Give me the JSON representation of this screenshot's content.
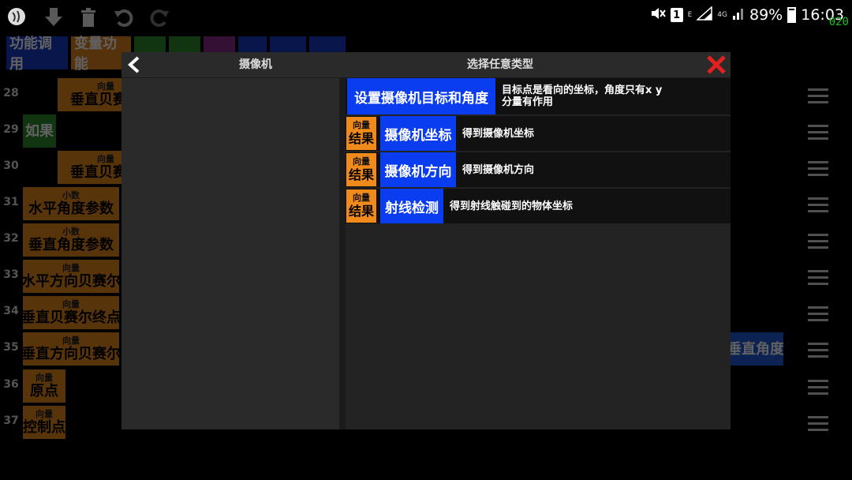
{
  "status_bar": {
    "mini_label_1": "E",
    "sim_badge": "1",
    "network": "4G",
    "battery_percent": "89%",
    "battery_level": 0.89,
    "time": "16:03",
    "fps": "020"
  },
  "background": {
    "tabs": [
      {
        "label": "功能调用",
        "color": "#1a3cc8"
      },
      {
        "label": "变量功能",
        "color": "#e08020"
      },
      {
        "label": "",
        "color": "#2f8a2f"
      },
      {
        "label": "",
        "color": "#2f8a2f"
      },
      {
        "label": "",
        "color": "#8a2f8a"
      },
      {
        "label": "",
        "color": "#1a3cc8"
      },
      {
        "label": "",
        "color": "#1a3cc8"
      },
      {
        "label": "",
        "color": "#1a3cc8"
      }
    ],
    "rows": [
      {
        "num": "28",
        "block_small": "向量",
        "block_large": "垂直贝赛尔"
      },
      {
        "num": "29",
        "block_small": "",
        "block_large": "如果"
      },
      {
        "num": "30",
        "block_small": "向量",
        "block_large": "垂直贝赛尔"
      },
      {
        "num": "31",
        "block_small": "小数",
        "block_large": "水平角度参数"
      },
      {
        "num": "32",
        "block_small": "小数",
        "block_large": "垂直角度参数"
      },
      {
        "num": "33",
        "block_small": "向量",
        "block_large": "水平方向贝赛尔"
      },
      {
        "num": "34",
        "block_small": "向量",
        "block_large": "垂直贝赛尔终点"
      },
      {
        "num": "35",
        "block_small": "向量",
        "block_large": "垂直方向贝赛尔"
      },
      {
        "num": "36",
        "block_small": "向量",
        "block_large": "原点"
      },
      {
        "num": "37",
        "block_small": "向量",
        "block_large": "控制点"
      }
    ],
    "right_text_35": "垂直角度"
  },
  "dialog": {
    "left_title": "摄像机",
    "right_title": "选择任意类型",
    "options": [
      {
        "badge_small": "",
        "badge_large": "",
        "name": "设置摄像机目标和角度",
        "desc": "目标点是看向的坐标，角度只有x y分量有作用"
      },
      {
        "badge_small": "向量",
        "badge_large": "结果",
        "name": "摄像机坐标",
        "desc": "得到摄像机坐标"
      },
      {
        "badge_small": "向量",
        "badge_large": "结果",
        "name": "摄像机方向",
        "desc": "得到摄像机方向"
      },
      {
        "badge_small": "向量",
        "badge_large": "结果",
        "name": "射线检测",
        "desc": "得到射线触碰到的物体坐标"
      }
    ]
  }
}
